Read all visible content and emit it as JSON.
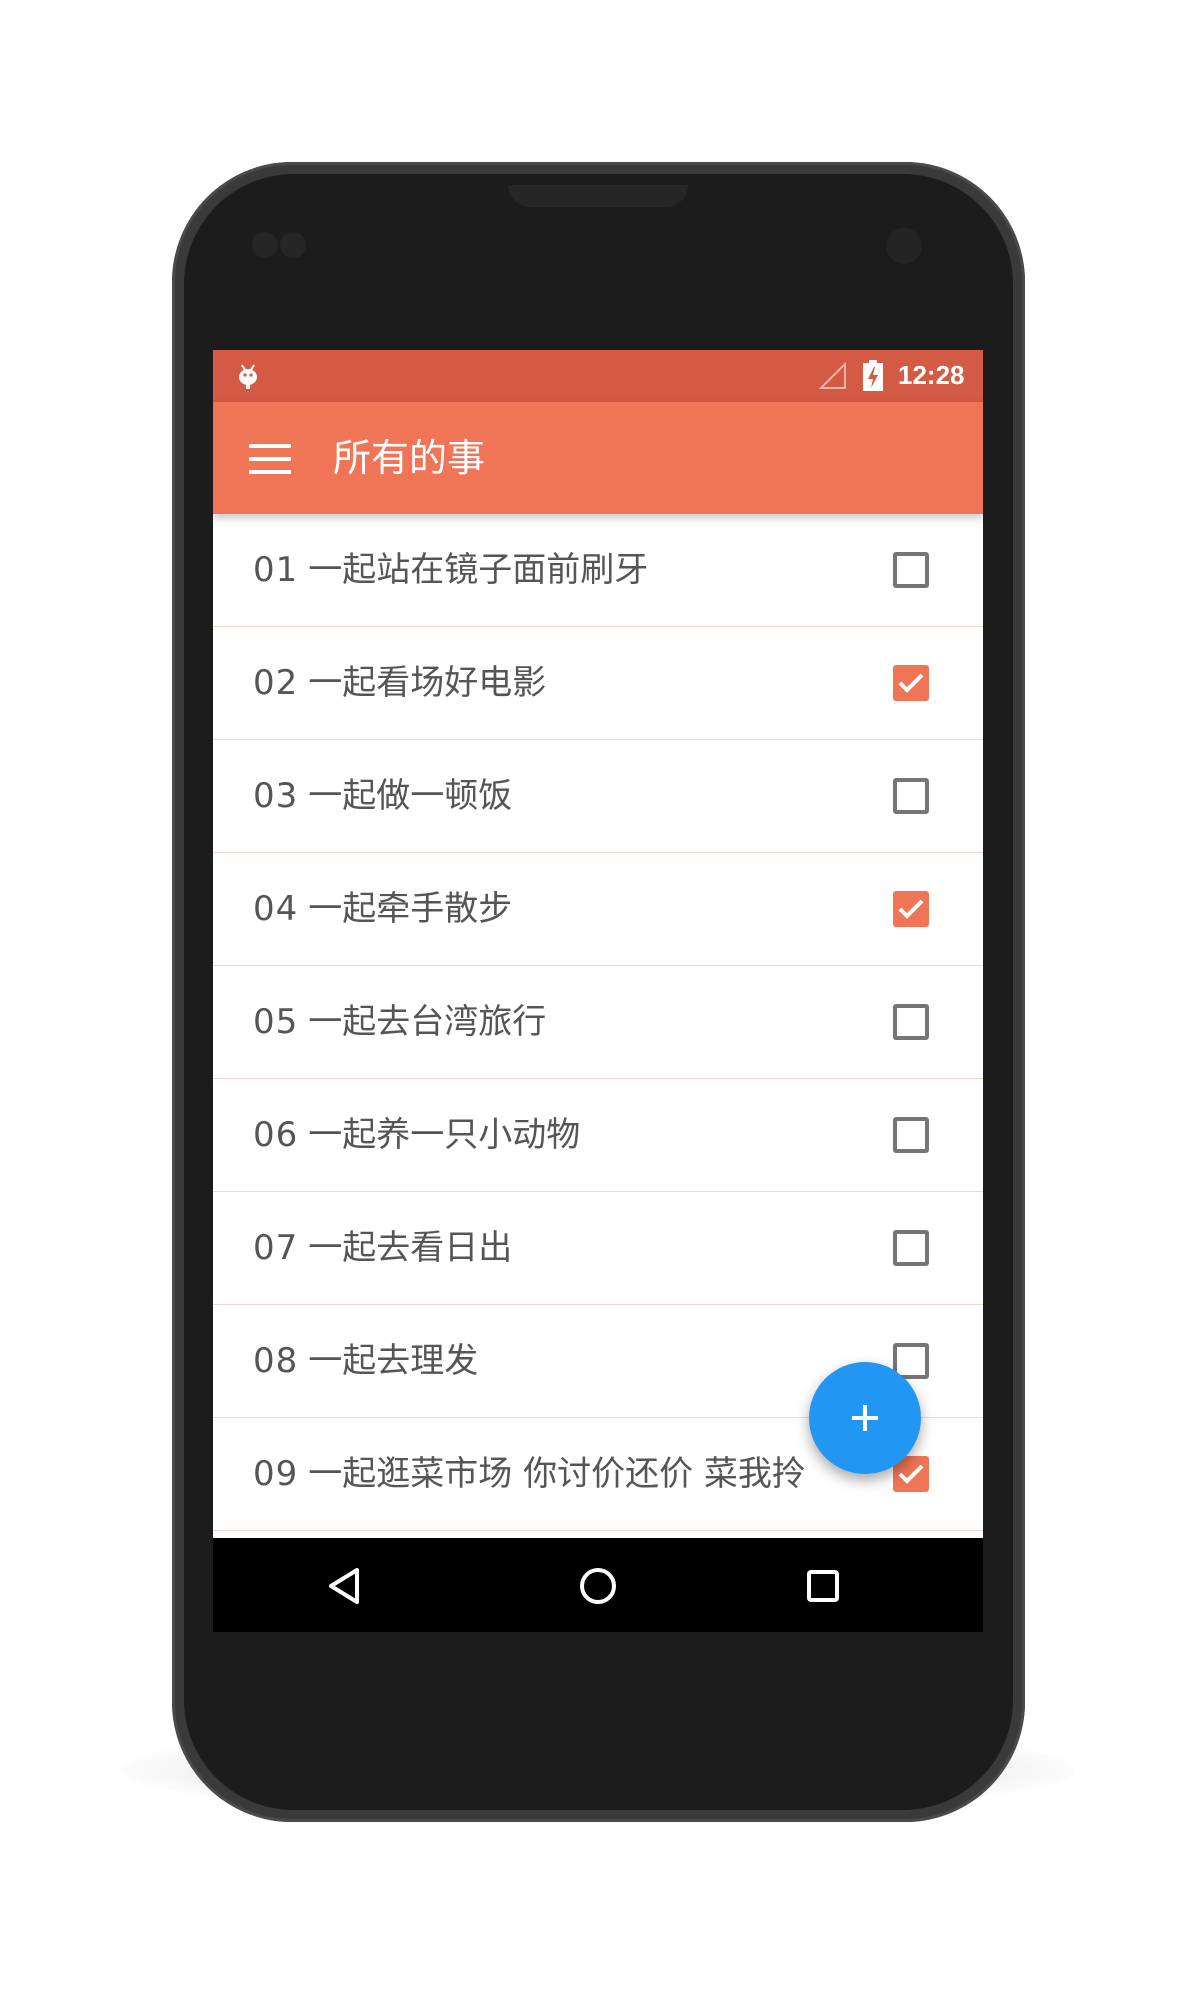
{
  "status_bar": {
    "time": "12:28",
    "android_icon": "android-debug-icon",
    "signal_icon": "signal-empty-icon",
    "battery_icon": "battery-charging-icon"
  },
  "app_bar": {
    "menu_icon": "hamburger-menu-icon",
    "title": "所有的事"
  },
  "todos": [
    {
      "number": "01",
      "text": "一起站在镜子面前刷牙",
      "checked": false
    },
    {
      "number": "02",
      "text": "一起看场好电影",
      "checked": true
    },
    {
      "number": "03",
      "text": "一起做一顿饭",
      "checked": false
    },
    {
      "number": "04",
      "text": "一起牵手散步",
      "checked": true
    },
    {
      "number": "05",
      "text": "一起去台湾旅行",
      "checked": false
    },
    {
      "number": "06",
      "text": "一起养一只小动物",
      "checked": false
    },
    {
      "number": "07",
      "text": "一起去看日出",
      "checked": false
    },
    {
      "number": "08",
      "text": "一起去理发",
      "checked": false
    },
    {
      "number": "09",
      "text": "一起逛菜市场 你讨价还价 菜我拎",
      "checked": true
    }
  ],
  "fab": {
    "icon": "plus-icon"
  },
  "nav_bar": {
    "back_icon": "back-triangle-icon",
    "home_icon": "home-circle-icon",
    "recents_icon": "recents-square-icon"
  },
  "colors": {
    "status_bar": "#d35a44",
    "app_bar": "#f07556",
    "accent_check": "#f07556",
    "fab": "#2196f3",
    "divider": "#f9d6cc"
  }
}
